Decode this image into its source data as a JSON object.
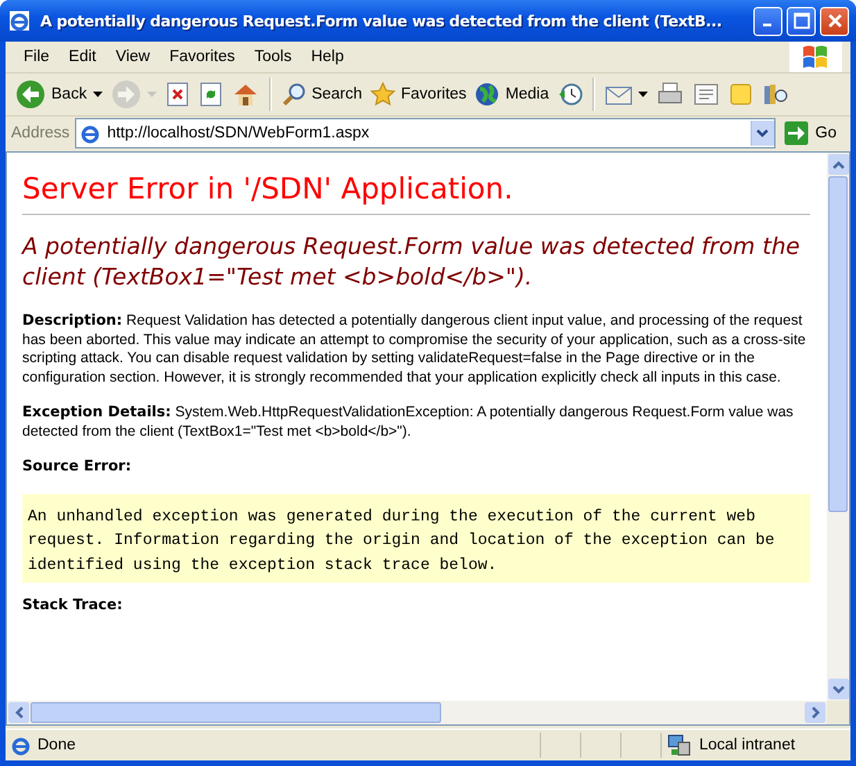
{
  "window": {
    "title": "A potentially dangerous Request.Form value was detected from the client (TextB..."
  },
  "menu": [
    "File",
    "Edit",
    "View",
    "Favorites",
    "Tools",
    "Help"
  ],
  "toolbar": [
    {
      "kind": "button",
      "label": "Back",
      "has_menu": true,
      "disabled": false
    },
    {
      "kind": "button",
      "has_menu": true,
      "disabled": true
    },
    {
      "kind": "button",
      "has_menu": false,
      "disabled": false
    },
    {
      "kind": "button",
      "has_menu": false,
      "disabled": false
    },
    {
      "kind": "button",
      "has_menu": false,
      "disabled": false
    },
    {
      "kind": "separator"
    },
    {
      "kind": "button",
      "label": "Search",
      "has_menu": false,
      "disabled": false
    },
    {
      "kind": "button",
      "label": "Favorites",
      "has_menu": false,
      "disabled": false
    },
    {
      "kind": "button",
      "label": "Media",
      "has_menu": false,
      "disabled": false
    },
    {
      "kind": "button",
      "has_menu": false,
      "disabled": false
    },
    {
      "kind": "separator"
    },
    {
      "kind": "button",
      "has_menu": true,
      "disabled": false
    },
    {
      "kind": "button",
      "has_menu": false,
      "disabled": false
    },
    {
      "kind": "button",
      "has_menu": false,
      "disabled": false
    },
    {
      "kind": "button",
      "has_menu": false,
      "disabled": false
    },
    {
      "kind": "button",
      "has_menu": false,
      "disabled": false
    }
  ],
  "address": {
    "label": "Address",
    "url": "http://localhost/SDN/WebForm1.aspx",
    "go": "Go"
  },
  "page": {
    "heading": "Server Error in '/SDN' Application.",
    "error_title": "A potentially dangerous Request.Form value was detected from the client (TextBox1=\"Test met <b>bold</b>\").",
    "sections": [
      {
        "kind": "text",
        "label": "Description:",
        "text": "Request Validation has detected a potentially dangerous client input value, and processing of the request has been aborted. This value may indicate an attempt to compromise the security of your application, such as a cross-site scripting attack. You can disable request validation by setting validateRequest=false in the Page directive or in the configuration section. However, it is strongly recommended that your application explicitly check all inputs in this case."
      },
      {
        "kind": "text",
        "label": "Exception Details:",
        "text": "System.Web.HttpRequestValidationException: A potentially dangerous Request.Form value was detected from the client (TextBox1=\"Test met <b>bold</b>\")."
      },
      {
        "kind": "heading",
        "label": "Source Error:"
      },
      {
        "kind": "code",
        "text": "An unhandled exception was generated during the execution of the current web request. Information regarding the origin and location of the exception can be identified using the exception stack trace below."
      },
      {
        "kind": "heading",
        "label": "Stack Trace:"
      }
    ]
  },
  "status": {
    "text": "Done",
    "zone": "Local intranet"
  }
}
